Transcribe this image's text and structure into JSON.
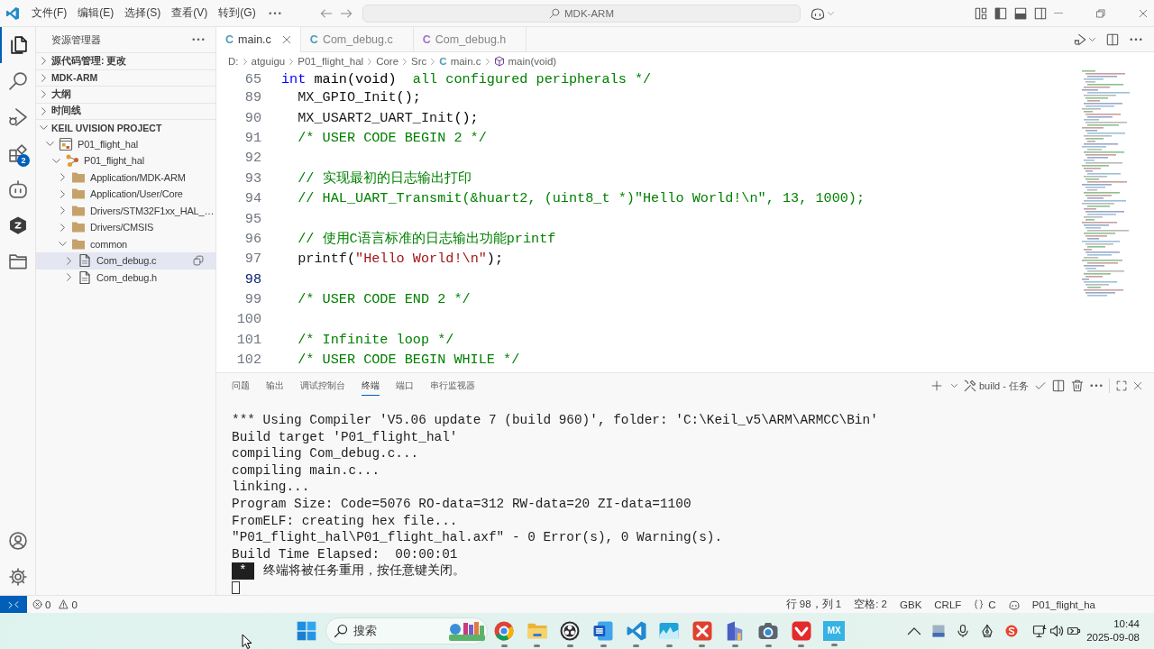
{
  "title_bar": {
    "menus": [
      "文件(F)",
      "编辑(E)",
      "选择(S)",
      "查看(V)",
      "转到(G)"
    ],
    "command_center": "MDK-ARM"
  },
  "activity_bar": {
    "items": [
      {
        "kind": "explorer",
        "selected": true
      },
      {
        "kind": "search",
        "selected": false
      },
      {
        "kind": "debug",
        "selected": false
      },
      {
        "kind": "extensions",
        "selected": false,
        "badge": "2"
      },
      {
        "kind": "assistant",
        "selected": false
      },
      {
        "kind": "hexagon",
        "selected": false
      },
      {
        "kind": "folder",
        "selected": false
      }
    ],
    "bottom": [
      {
        "kind": "account"
      },
      {
        "kind": "settings"
      }
    ]
  },
  "sidebar": {
    "title": "资源管理器",
    "sections": [
      {
        "label": "源代码管理: 更改",
        "expanded": false
      },
      {
        "label": "MDK-ARM",
        "expanded": false
      },
      {
        "label": "大纲",
        "expanded": false
      },
      {
        "label": "时间线",
        "expanded": false
      },
      {
        "label": "KEIL UVISION PROJECT",
        "expanded": true,
        "items": [
          {
            "kind": "project",
            "label": "P01_flight_hal",
            "expanded": true,
            "selected": false,
            "children": [
              {
                "kind": "target",
                "label": "P01_flight_hal",
                "expanded": true,
                "selected": false,
                "children": [
                  {
                    "kind": "folder",
                    "label": "Application/MDK-ARM",
                    "expanded": false,
                    "selected": false
                  },
                  {
                    "kind": "folder",
                    "label": "Application/User/Core",
                    "expanded": false,
                    "selected": false
                  },
                  {
                    "kind": "folder",
                    "label": "Drivers/STM32F1xx_HAL_…",
                    "expanded": false,
                    "selected": false
                  },
                  {
                    "kind": "folder",
                    "label": "Drivers/CMSIS",
                    "expanded": false,
                    "selected": false
                  },
                  {
                    "kind": "folder",
                    "label": "common",
                    "expanded": true,
                    "selected": false,
                    "children": [
                      {
                        "kind": "file",
                        "label": "Com_debug.c",
                        "expanded": false,
                        "selected": true
                      },
                      {
                        "kind": "file",
                        "label": "Com_debug.h",
                        "expanded": false,
                        "selected": false
                      }
                    ]
                  }
                ]
              }
            ]
          }
        ]
      }
    ]
  },
  "editor": {
    "tabs": [
      {
        "icon": "C",
        "label": "main.c",
        "kind": "source",
        "selected": true
      },
      {
        "icon": "C",
        "label": "Com_debug.c",
        "kind": "source",
        "selected": false
      },
      {
        "icon": "C",
        "label": "Com_debug.h",
        "kind": "header",
        "selected": false
      }
    ],
    "breadcrumb": [
      {
        "kind": "folder",
        "label": "D:"
      },
      {
        "kind": "folder",
        "label": "atguigu"
      },
      {
        "kind": "folder",
        "label": "P01_flight_hal"
      },
      {
        "kind": "folder",
        "label": "Core"
      },
      {
        "kind": "folder",
        "label": "Src"
      },
      {
        "kind": "file",
        "icon": "C",
        "label": "main.c"
      },
      {
        "kind": "symbol",
        "label": "main(void)"
      }
    ],
    "sticky_line": {
      "number": "65",
      "tokens": [
        {
          "kind": "keyword",
          "text": "int"
        },
        {
          "kind": "plain",
          "text": " main(void)"
        }
      ],
      "overlapped_text": "all configured peripherals */"
    },
    "lines": [
      {
        "number": "89",
        "active": false,
        "tokens": [
          {
            "kind": "function",
            "text": "MX_GPIO_Init"
          },
          {
            "kind": "plain",
            "text": "();"
          }
        ]
      },
      {
        "number": "90",
        "active": false,
        "tokens": [
          {
            "kind": "function",
            "text": "MX_USART2_UART_Init"
          },
          {
            "kind": "plain",
            "text": "();"
          }
        ]
      },
      {
        "number": "91",
        "active": false,
        "tokens": [
          {
            "kind": "comment",
            "text": "/* USER CODE BEGIN 2 */"
          }
        ]
      },
      {
        "number": "92",
        "active": false
      },
      {
        "number": "93",
        "active": false,
        "tokens": [
          {
            "kind": "comment",
            "text": "// 实现最初的日志输出打印"
          }
        ]
      },
      {
        "number": "94",
        "active": false,
        "tokens": [
          {
            "kind": "comment",
            "text": "// HAL_UART_Transmit(&huart2, (uint8_t *)\"Hello World!\\n\", 13, 1000);"
          }
        ]
      },
      {
        "number": "95",
        "active": false
      },
      {
        "number": "96",
        "active": false,
        "tokens": [
          {
            "kind": "comment",
            "text": "// 使用C语言标准的日志输出功能printf"
          }
        ]
      },
      {
        "number": "97",
        "active": false,
        "tokens": [
          {
            "kind": "function",
            "text": "printf"
          },
          {
            "kind": "plain",
            "text": "("
          },
          {
            "kind": "string",
            "text": "\"Hello World!\\n\""
          },
          {
            "kind": "plain",
            "text": ");"
          }
        ]
      },
      {
        "number": "98",
        "active": true
      },
      {
        "number": "99",
        "active": false,
        "tokens": [
          {
            "kind": "comment",
            "text": "/* USER CODE END 2 */"
          }
        ]
      },
      {
        "number": "100",
        "active": false
      },
      {
        "number": "101",
        "active": false,
        "tokens": [
          {
            "kind": "comment",
            "text": "/* Infinite loop */"
          }
        ]
      },
      {
        "number": "102",
        "active": false,
        "tokens": [
          {
            "kind": "comment",
            "text": "/* USER CODE BEGIN WHILE */"
          }
        ]
      }
    ]
  },
  "panel": {
    "tabs": [
      {
        "label": "问题",
        "selected": false
      },
      {
        "label": "输出",
        "selected": false
      },
      {
        "label": "调试控制台",
        "selected": false
      },
      {
        "label": "终端",
        "selected": true
      },
      {
        "label": "端口",
        "selected": false
      },
      {
        "label": "串行监视器",
        "selected": false
      }
    ],
    "task": "build - 任务",
    "terminal": {
      "lines": [
        "*** Using Compiler 'V5.06 update 7 (build 960)', folder: 'C:\\Keil_v5\\ARM\\ARMCC\\Bin'",
        "Build target 'P01_flight_hal'",
        "compiling Com_debug.c...",
        "compiling main.c...",
        "linking...",
        "Program Size: Code=5076 RO-data=312 RW-data=20 ZI-data=1100",
        "FromELF: creating hex file...",
        "\"P01_flight_hal\\P01_flight_hal.axf\" - 0 Error(s), 0 Warning(s).",
        "Build Time Elapsed:  00:00:01"
      ],
      "notice": {
        "badge": "*",
        "text": "终端将被任务重用，按任意键关闭。"
      }
    }
  },
  "status_bar": {
    "errors": "0",
    "warnings": "0",
    "items": [
      {
        "kind": "text",
        "label": "行 98，列 1"
      },
      {
        "kind": "text",
        "label": "空格: 2"
      },
      {
        "kind": "text",
        "label": "GBK"
      },
      {
        "kind": "text",
        "label": "CRLF"
      },
      {
        "kind": "language",
        "label": "C"
      },
      {
        "kind": "copilot"
      },
      {
        "kind": "text",
        "label": "P01_flight_ha"
      }
    ]
  },
  "taskbar": {
    "search": {
      "placeholder": "搜索"
    },
    "apps": [
      {
        "kind": "browser",
        "running": true
      },
      {
        "kind": "files",
        "running": true
      },
      {
        "kind": "recorder",
        "running": true
      },
      {
        "kind": "document",
        "running": true
      },
      {
        "kind": "editor",
        "running": true
      },
      {
        "kind": "waveform",
        "running": true
      },
      {
        "kind": "cross",
        "running": true
      },
      {
        "kind": "building",
        "running": true
      },
      {
        "kind": "camera",
        "running": true
      },
      {
        "kind": "office",
        "running": true
      },
      {
        "kind": "tile",
        "label": "MX",
        "running": true
      }
    ],
    "tray": [
      {
        "kind": "chevron"
      },
      {
        "kind": "app"
      },
      {
        "kind": "microphone"
      },
      {
        "kind": "pen"
      },
      {
        "kind": "ime"
      },
      {
        "kind": "network"
      },
      {
        "kind": "volume"
      },
      {
        "kind": "battery"
      }
    ],
    "clock": {
      "time": "10:44",
      "date": "2025-09-08"
    }
  }
}
